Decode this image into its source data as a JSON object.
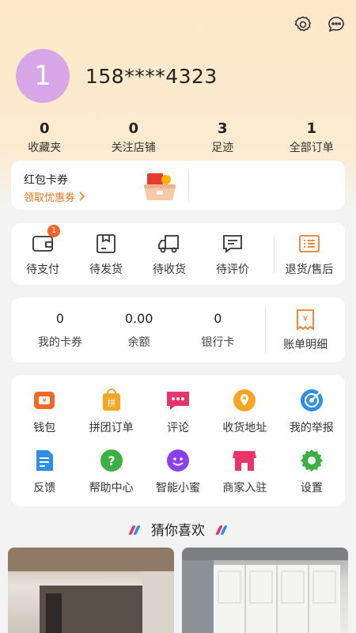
{
  "header": {
    "settings_icon": "gear-icon",
    "message_icon": "chat-bubble-icon"
  },
  "profile": {
    "avatar_text": "1",
    "phone": "158****4323",
    "avatar_color": "#d6a6e6"
  },
  "stats": [
    {
      "num": "0",
      "label": "收藏夹"
    },
    {
      "num": "0",
      "label": "关注店铺"
    },
    {
      "num": "3",
      "label": "足迹"
    },
    {
      "num": "1",
      "label": "全部订单"
    }
  ],
  "coupon": {
    "title": "红包卡券",
    "link": "领取优惠券"
  },
  "orders": {
    "pending_pay": {
      "label": "待支付",
      "badge": "1"
    },
    "pending_ship": {
      "label": "待发货"
    },
    "pending_receive": {
      "label": "待收货"
    },
    "pending_review": {
      "label": "待评价"
    },
    "returns": {
      "label": "退货/售后"
    }
  },
  "wallet": {
    "cards": {
      "num": "0",
      "label": "我的卡券"
    },
    "balance": {
      "num": "0.00",
      "label": "余额"
    },
    "bank": {
      "num": "0",
      "label": "银行卡"
    },
    "bill": {
      "label": "账单明细"
    }
  },
  "tools_row1": [
    {
      "label": "钱包",
      "icon": "wallet-icon"
    },
    {
      "label": "拼团订单",
      "icon": "group-order-icon"
    },
    {
      "label": "评论",
      "icon": "comment-icon"
    },
    {
      "label": "收货地址",
      "icon": "location-icon"
    },
    {
      "label": "我的举报",
      "icon": "report-icon"
    }
  ],
  "tools_row2": [
    {
      "label": "反馈",
      "icon": "feedback-icon"
    },
    {
      "label": "帮助中心",
      "icon": "help-icon"
    },
    {
      "label": "智能小蜜",
      "icon": "assistant-icon"
    },
    {
      "label": "商家入驻",
      "icon": "store-icon"
    },
    {
      "label": "设置",
      "icon": "settings-icon"
    }
  ],
  "guess": {
    "title": "猜你喜欢"
  },
  "colors": {
    "accent": "#e4761a",
    "badge": "#f0632b",
    "page_bg": "#f3f3f3",
    "header_bg": "#fde9c8"
  }
}
